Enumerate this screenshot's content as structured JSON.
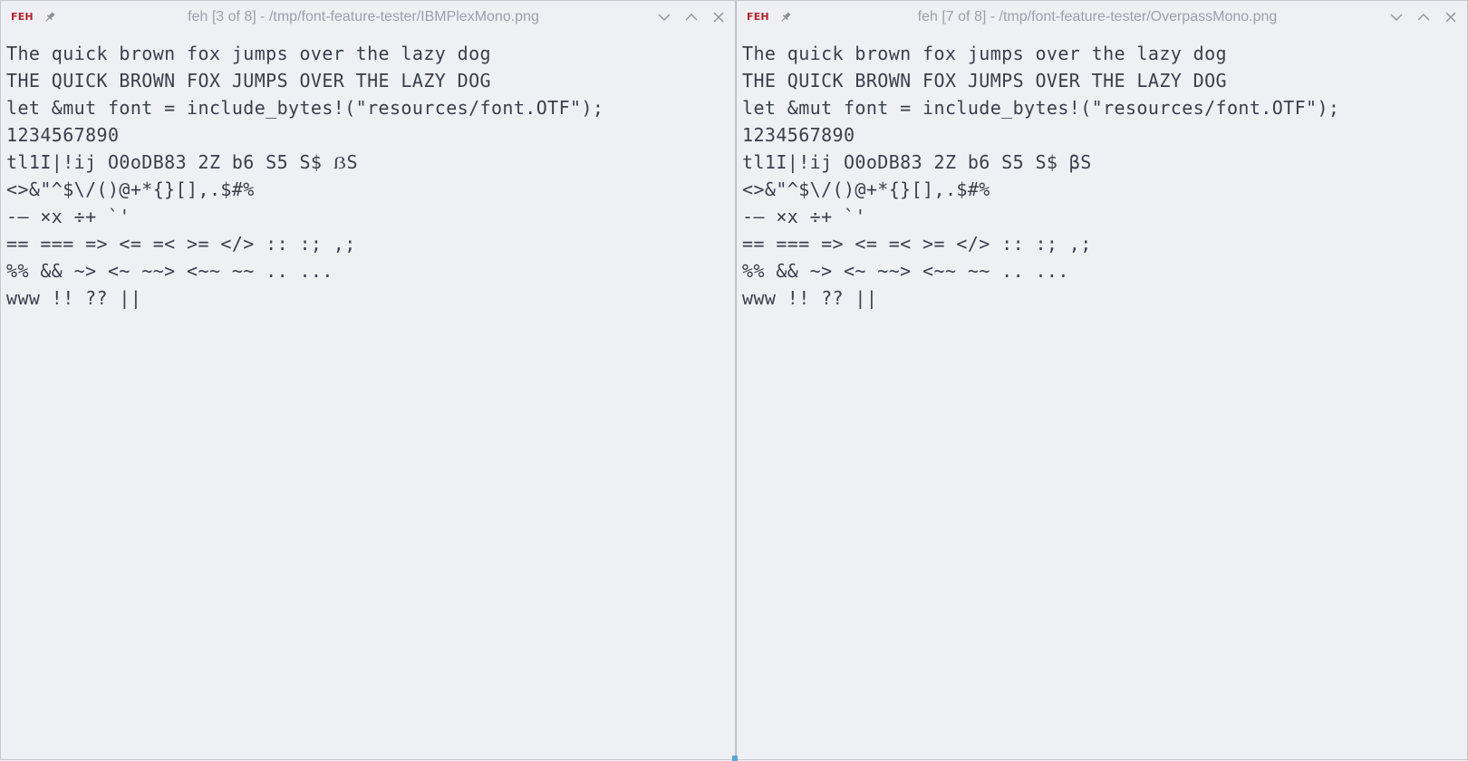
{
  "windows": [
    {
      "logo": "FEH",
      "title": "feh [3 of 8] - /tmp/font-feature-tester/IBMPlexMono.png",
      "lines": [
        "The quick brown fox jumps over the lazy dog",
        "THE QUICK BROWN FOX JUMPS OVER THE LAZY DOG",
        "let &mut font = include_bytes!(\"resources/font.OTF\");",
        "1234567890",
        "tl1I|!ij O0oDB83 2Z b6 S5 S$ ẞS",
        "<>&\"^$\\/()@+*{}[],.$#%",
        "-— ×x ÷+ `'",
        "== === => <= =< >= </> :: :; ,;",
        "%% && ~> <~ ~~> <~~ ~~ .. ...",
        "www !! ?? ||"
      ]
    },
    {
      "logo": "FEH",
      "title": "feh [7 of 8] - /tmp/font-feature-tester/OverpassMono.png",
      "lines": [
        "The quick brown fox jumps over the lazy dog",
        "THE QUICK BROWN FOX JUMPS OVER THE LAZY DOG",
        "let &mut font = include_bytes!(\"resources/font.OTF\");",
        "1234567890",
        "tl1I|!ij O0oDB83 2Z b6 S5 S$ βS",
        "<>&\"^$\\/()@+*{}[],.$#%",
        "-— ×x ÷+ `'",
        "== === => <= =< >= </> :: :; ,;",
        "%% && ~> <~ ~~> <~~ ~~ .. ...",
        "www !! ?? ||"
      ]
    }
  ],
  "icons": {
    "pin": "pin-icon",
    "minimize": "chevron-down-icon",
    "maximize": "chevron-up-icon",
    "close": "close-icon"
  },
  "colors": {
    "background": "#eff0f4",
    "text": "#3b3f4c",
    "title_text": "#9da0aa",
    "logo_accent": "#b5202c"
  }
}
